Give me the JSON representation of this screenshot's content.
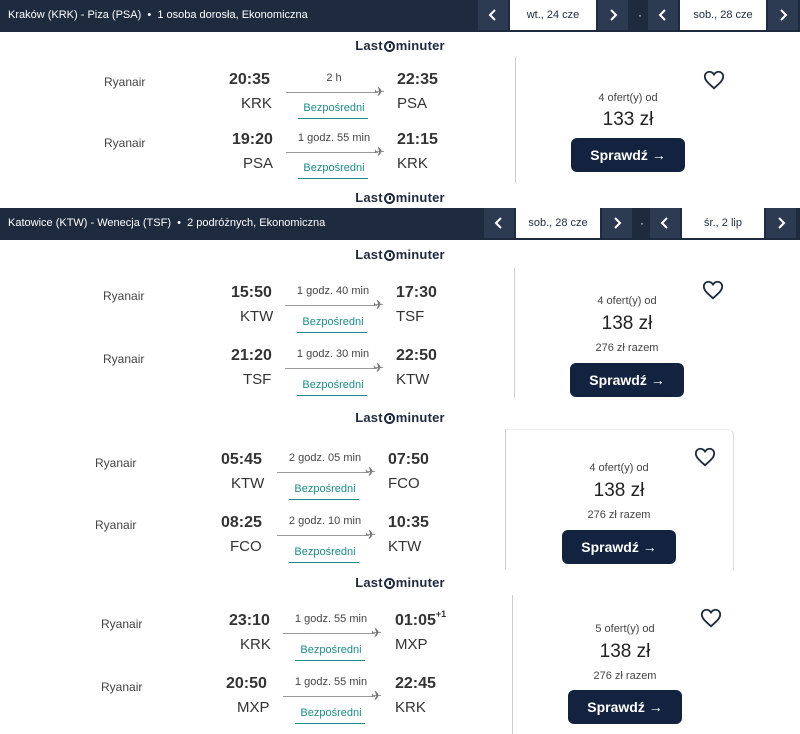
{
  "searches": [
    {
      "route": "Kraków (KRK) - Piza (PSA)",
      "passengers": "1 osoba dorosła, Ekonomiczna",
      "date_out": "wt., 24 cze",
      "date_back": "sob., 28 cze"
    },
    {
      "route": "Katowice (KTW) - Wenecja (TSF)",
      "passengers": "2 podróżnych, Ekonomiczna",
      "date_out": "sob., 28 cze",
      "date_back": "śr., 2 lip"
    }
  ],
  "logo": {
    "left": "Last",
    "right": "minuter"
  },
  "cards": [
    {
      "out": {
        "airline": "Ryanair",
        "dep_time": "20:35",
        "dep_code": "KRK",
        "duration": "2 h",
        "stops": "Bezpośredni",
        "arr_time": "22:35",
        "arr_code": "PSA"
      },
      "ret": {
        "airline": "Ryanair",
        "dep_time": "19:20",
        "dep_code": "PSA",
        "duration": "1 godz. 55 min",
        "stops": "Bezpośredni",
        "arr_time": "21:15",
        "arr_code": "KRK"
      },
      "offers": "4 ofert(y) od",
      "price": "133 zł",
      "total": "",
      "button": "Sprawdź →"
    },
    {
      "out": {
        "airline": "Ryanair",
        "dep_time": "15:50",
        "dep_code": "KTW",
        "duration": "1 godz. 40 min",
        "stops": "Bezpośredni",
        "arr_time": "17:30",
        "arr_code": "TSF"
      },
      "ret": {
        "airline": "Ryanair",
        "dep_time": "21:20",
        "dep_code": "TSF",
        "duration": "1 godz. 30 min",
        "stops": "Bezpośredni",
        "arr_time": "22:50",
        "arr_code": "KTW"
      },
      "offers": "4 ofert(y) od",
      "price": "138 zł",
      "total": "276 zł razem",
      "button": "Sprawdź →"
    },
    {
      "out": {
        "airline": "Ryanair",
        "dep_time": "05:45",
        "dep_code": "KTW",
        "duration": "2 godz. 05 min",
        "stops": "Bezpośredni",
        "arr_time": "07:50",
        "arr_code": "FCO"
      },
      "ret": {
        "airline": "Ryanair",
        "dep_time": "08:25",
        "dep_code": "FCO",
        "duration": "2 godz. 10 min",
        "stops": "Bezpośredni",
        "arr_time": "10:35",
        "arr_code": "KTW"
      },
      "offers": "4 ofert(y) od",
      "price": "138 zł",
      "total": "276 zł razem",
      "button": "Sprawdź →"
    },
    {
      "out": {
        "airline": "Ryanair",
        "dep_time": "23:10",
        "dep_code": "KRK",
        "duration": "1 godz. 55 min",
        "stops": "Bezpośredni",
        "arr_time": "01:05",
        "arr_plus": "+1",
        "arr_code": "MXP"
      },
      "ret": {
        "airline": "Ryanair",
        "dep_time": "20:50",
        "dep_code": "MXP",
        "duration": "1 godz. 55 min",
        "stops": "Bezpośredni",
        "arr_time": "22:45",
        "arr_code": "KRK"
      },
      "offers": "5 ofert(y) od",
      "price": "138 zł",
      "total": "276 zł razem",
      "button": "Sprawdź →"
    }
  ],
  "icons": {
    "prev": "chevron-left-icon",
    "next": "chevron-right-icon",
    "favorite": "heart-icon",
    "plane": "plane-icon"
  },
  "colors": {
    "header_bg": "#1e2a3d",
    "button_bg": "#13233f",
    "direct": "#1f8a8a"
  }
}
